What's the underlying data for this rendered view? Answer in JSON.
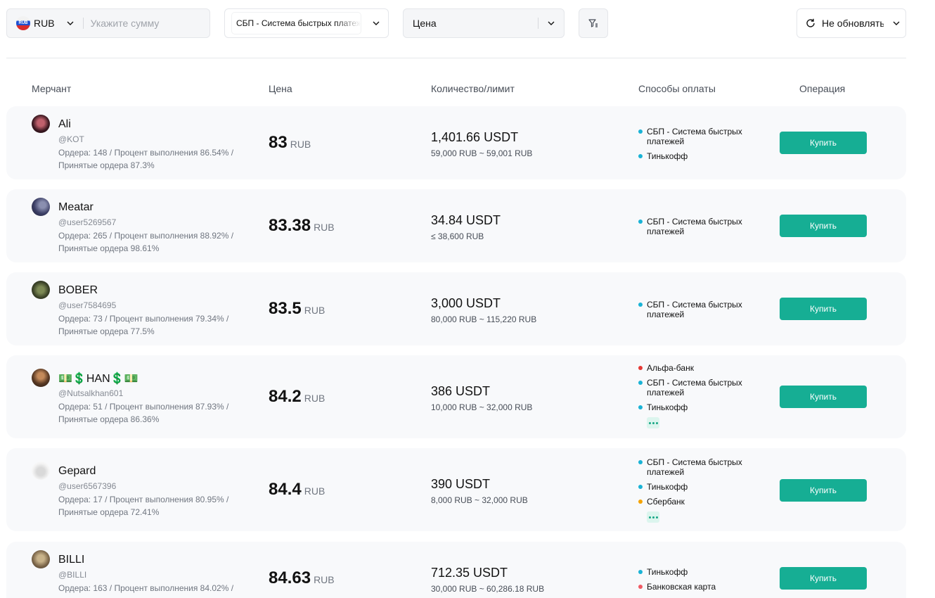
{
  "filters": {
    "currency": {
      "code": "RUB",
      "flag_text": "RUB",
      "placeholder": "Укажите сумму"
    },
    "payment": {
      "label": "СБП - Система быстрых платежей"
    },
    "sort": {
      "label": "Цена"
    },
    "refresh": {
      "label": "Не обновлять"
    }
  },
  "table": {
    "headers": {
      "merchant": "Мерчант",
      "price": "Цена",
      "quantity": "Количество/лимит",
      "methods": "Способы оплаты",
      "operation": "Операция"
    },
    "buy_label": "Купить",
    "rows": [
      {
        "name": "Ali",
        "handle": "@KOT",
        "stats": "Ордера: 148 / Процент выполнения 86.54% / Принятые ордера 87.3%",
        "price": "83",
        "price_currency": "RUB",
        "quantity": "1,401.66 USDT",
        "limit": "59,000 RUB ~ 59,001 RUB",
        "methods": [
          {
            "label": "СБП - Система быстрых платежей",
            "color": "#1ab3d6"
          },
          {
            "label": "Тинькофф",
            "color": "#1ab3d6"
          }
        ]
      },
      {
        "name": "Meatar",
        "handle": "@user5269567",
        "stats": "Ордера: 265 / Процент выполнения 88.92% / Принятые ордера 98.61%",
        "price": "83.38",
        "price_currency": "RUB",
        "quantity": "34.84 USDT",
        "limit": "≤ 38,600 RUB",
        "methods": [
          {
            "label": "СБП - Система быстрых платежей",
            "color": "#1ab3d6"
          }
        ]
      },
      {
        "name": "BOBER",
        "handle": "@user7584695",
        "stats": "Ордера: 73 / Процент выполнения 79.34% / Принятые ордера 77.5%",
        "price": "83.5",
        "price_currency": "RUB",
        "quantity": "3,000 USDT",
        "limit": "80,000 RUB ~ 115,220 RUB",
        "methods": [
          {
            "label": "СБП - Система быстрых платежей",
            "color": "#1ab3d6"
          }
        ]
      },
      {
        "name": "💵💲HAN💲💵",
        "handle": "@Nutsalkhan601",
        "stats": "Ордера: 51 / Процент выполнения 87.93% / Принятые ордера 86.36%",
        "price": "84.2",
        "price_currency": "RUB",
        "quantity": "386 USDT",
        "limit": "10,000 RUB ~ 32,000 RUB",
        "methods": [
          {
            "label": "Альфа-банк",
            "color": "#e53935"
          },
          {
            "label": "СБП - Система быстрых платежей",
            "color": "#1ab3d6"
          },
          {
            "label": "Тинькофф",
            "color": "#1ab3d6"
          }
        ],
        "more": true
      },
      {
        "name": "Gepard",
        "handle": "@user6567396",
        "stats": "Ордера: 17 / Процент выполнения 80.95% / Принятые ордера 72.41%",
        "price": "84.4",
        "price_currency": "RUB",
        "quantity": "390 USDT",
        "limit": "8,000 RUB ~ 32,000 RUB",
        "methods": [
          {
            "label": "СБП - Система быстрых платежей",
            "color": "#1ab3d6"
          },
          {
            "label": "Тинькофф",
            "color": "#1ab3d6"
          },
          {
            "label": "Сбербанк",
            "color": "#f5a300"
          }
        ],
        "more": true
      },
      {
        "name": "BILLI",
        "handle": "@BILLI",
        "stats": "Ордера: 163 / Процент выполнения 84.02% /",
        "price": "84.63",
        "price_currency": "RUB",
        "quantity": "712.35 USDT",
        "limit": "30,000 RUB ~ 60,286.18 RUB",
        "methods": [
          {
            "label": "Тинькофф",
            "color": "#1ab3d6"
          },
          {
            "label": "Банковская карта",
            "color": "#f05a64"
          }
        ]
      }
    ]
  },
  "icons": {
    "chevron": "chevron-down-icon",
    "filter": "filter-icon",
    "refresh": "refresh-icon",
    "flag": "rub-flag-icon"
  },
  "colors": {
    "buy_button": "#16ae94",
    "row_background": "#f8f9fb"
  }
}
